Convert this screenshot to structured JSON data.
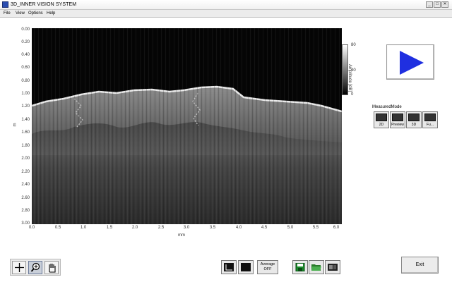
{
  "window": {
    "title": "3D_INNER VISION SYSTEM",
    "minimize": "_",
    "maximize": "□",
    "close": "✕"
  },
  "menu": [
    "File",
    "View",
    "Options",
    "Help"
  ],
  "plot": {
    "y_ticks": [
      "0.00",
      "0.20",
      "0.40",
      "0.60",
      "0.80",
      "1.00",
      "1.20",
      "1.40",
      "1.60",
      "1.80",
      "2.00",
      "2.20",
      "2.40",
      "2.60",
      "2.80",
      "3.00"
    ],
    "x_ticks": [
      "0.0",
      "0.5",
      "1.0",
      "1.5",
      "2.0",
      "2.5",
      "3.0",
      "3.5",
      "4.0",
      "4.5",
      "5.0",
      "5.5",
      "6.0"
    ],
    "y_unit": "m",
    "x_unit": "mm",
    "colors": {
      "background": "#050505",
      "surface": "#ffffff"
    }
  },
  "colorbar": {
    "ticks": [
      "80",
      "40",
      "0"
    ],
    "label": "Amplitude [dB]"
  },
  "play": {
    "icon": "play-icon",
    "color": "#1f2fe0"
  },
  "measured_mode": {
    "label": "MeasuredMode",
    "buttons": [
      "2D",
      "Preview",
      "3D",
      "Fu..."
    ]
  },
  "tools": [
    "crosshair-icon",
    "zoom-icon",
    "pan-hand-icon"
  ],
  "bottom": {
    "average_line1": "Average",
    "average_line2": "OFF",
    "exit": "Exit"
  }
}
